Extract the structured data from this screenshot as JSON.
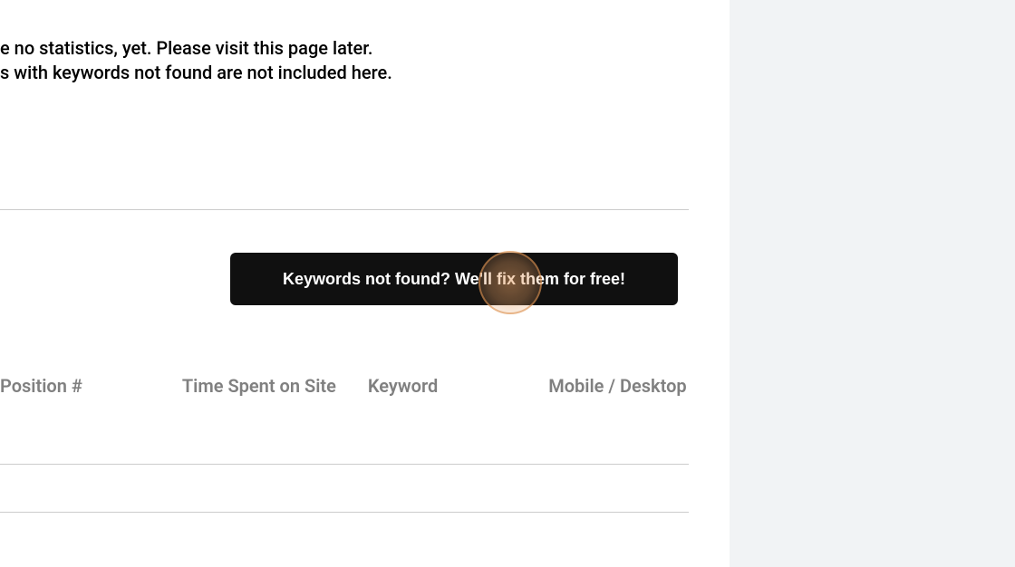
{
  "message": {
    "line1": "e no statistics, yet. Please visit this page later.",
    "line2": "s with keywords not found are not included here."
  },
  "cta": {
    "label": "Keywords not found? We'll fix them for free!"
  },
  "table": {
    "headers": {
      "position": "Position #",
      "time_spent": "Time Spent on Site",
      "keyword": "Keyword",
      "device": "Mobile / Desktop"
    }
  }
}
